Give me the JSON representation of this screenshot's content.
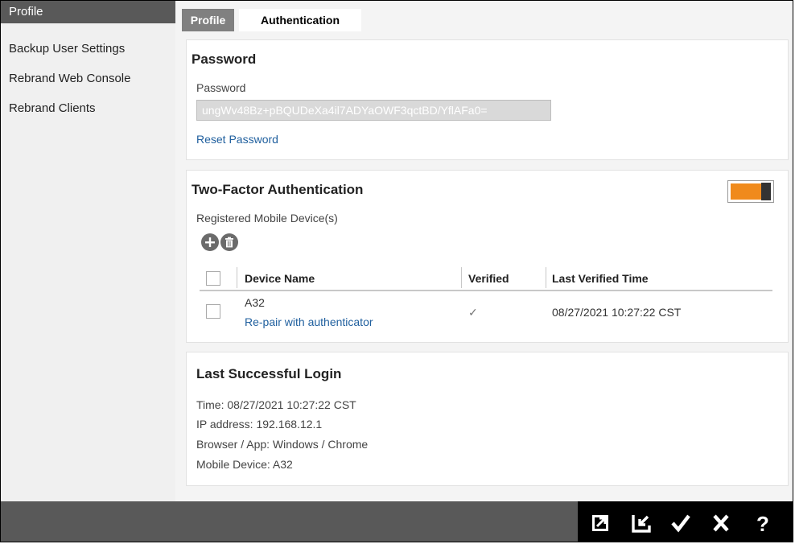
{
  "sidebar": {
    "items": [
      {
        "label": "Profile",
        "active": true
      },
      {
        "label": "Backup User Settings",
        "active": false
      },
      {
        "label": "Rebrand Web Console",
        "active": false
      },
      {
        "label": "Rebrand Clients",
        "active": false
      }
    ]
  },
  "tabs": [
    {
      "label": "Profile",
      "active": false
    },
    {
      "label": "Authentication",
      "active": true
    }
  ],
  "password_panel": {
    "title": "Password",
    "field_label": "Password",
    "value": "ungWv48Bz+pBQUDeXa4il7ADYaOWF3qctBD/YflAFa0=",
    "reset_link": "Reset Password"
  },
  "two_factor": {
    "title": "Two-Factor Authentication",
    "enabled": true,
    "subtitle": "Registered Mobile Device(s)",
    "columns": {
      "device_name": "Device Name",
      "verified": "Verified",
      "last_verified_time": "Last Verified Time"
    },
    "rows": [
      {
        "device_name": "A32",
        "repair_link": "Re-pair with authenticator",
        "verified": "✓",
        "last_verified_time": "08/27/2021 10:27:22 CST"
      }
    ]
  },
  "last_login": {
    "title": "Last Successful Login",
    "time": "Time: 08/27/2021 10:27:22 CST",
    "ip": "IP address: 192.168.12.1",
    "browser": "Browser / App: Windows / Chrome",
    "device": "Mobile Device: A32"
  },
  "colors": {
    "accent": "#f08a1c",
    "link": "#1f5f9e",
    "sidebar_active": "#595959"
  },
  "action_icons": [
    "export-icon",
    "import-icon",
    "checkmark-icon",
    "close-icon",
    "help-icon"
  ]
}
